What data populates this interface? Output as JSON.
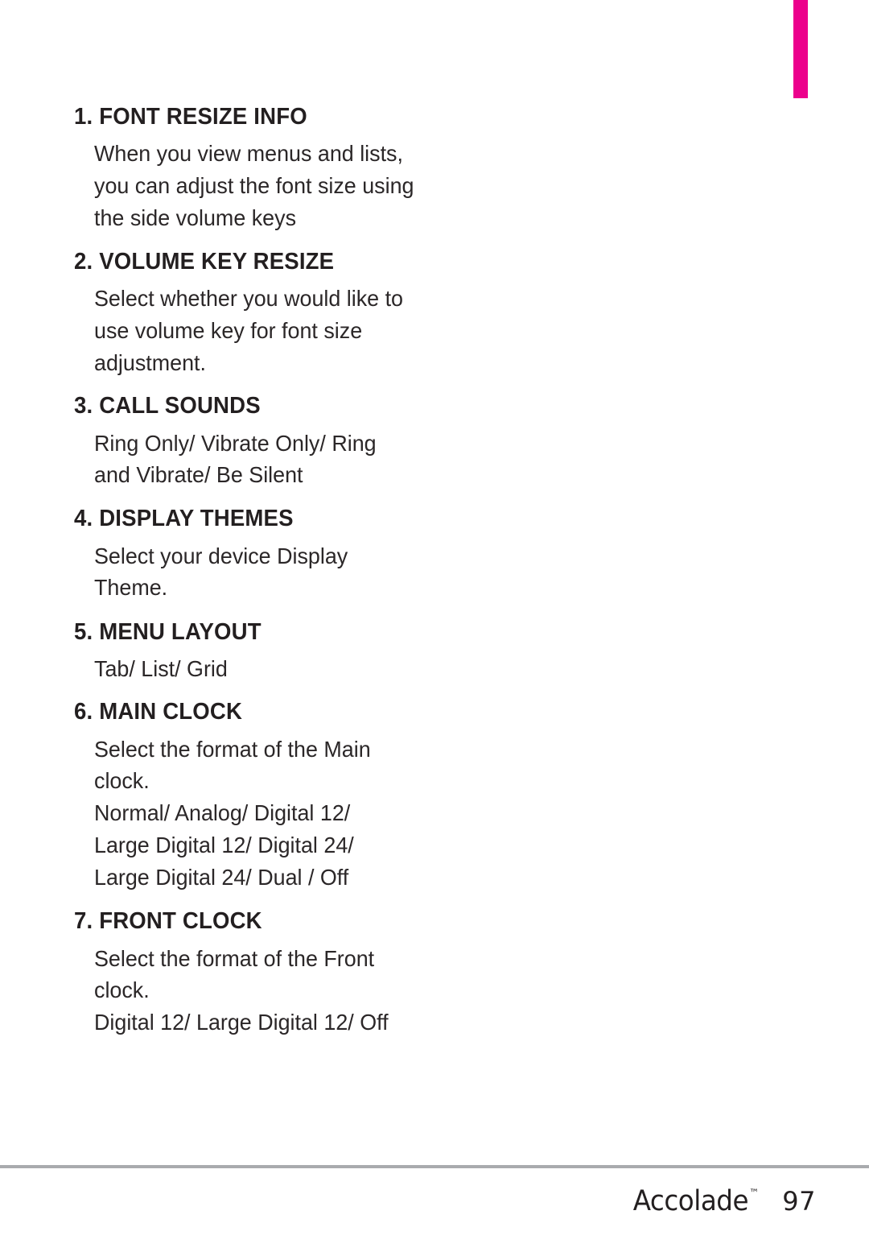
{
  "page": {
    "accent_color": "#ec018c",
    "rule_color": "#a9abae",
    "text_color": "#231f20"
  },
  "sections": [
    {
      "heading": "1. FONT RESIZE INFO",
      "lines": [
        "When you view menus and lists,",
        "you can adjust the font size using",
        "the side volume keys"
      ]
    },
    {
      "heading": "2. VOLUME KEY RESIZE",
      "lines": [
        "Select whether you would like to",
        "use volume key for font size",
        "adjustment."
      ]
    },
    {
      "heading": "3. CALL SOUNDS",
      "lines": [
        "Ring Only/ Vibrate Only/ Ring",
        "and Vibrate/ Be Silent"
      ]
    },
    {
      "heading": "4. DISPLAY THEMES",
      "lines": [
        "Select your device Display",
        "Theme."
      ]
    },
    {
      "heading": "5. MENU LAYOUT",
      "lines": [
        "Tab/ List/ Grid"
      ]
    },
    {
      "heading": "6. MAIN CLOCK",
      "lines": [
        "Select the format of the Main",
        "clock.",
        "Normal/ Analog/ Digital 12/",
        "Large Digital 12/ Digital 24/",
        "Large Digital 24/ Dual / Off"
      ]
    },
    {
      "heading": "7. FRONT CLOCK",
      "lines": [
        "Select the format of the Front",
        "clock.",
        "Digital 12/ Large Digital 12/ Off"
      ]
    }
  ],
  "footer": {
    "brand": "Accolade",
    "trademark": "™",
    "page_number": "97"
  }
}
